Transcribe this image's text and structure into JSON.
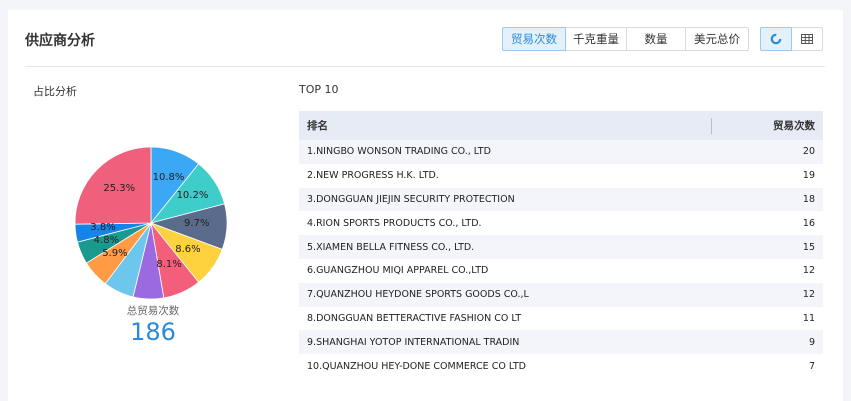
{
  "panel": {
    "title": "供应商分析"
  },
  "metric_tabs": [
    {
      "label": "贸易次数",
      "active": true
    },
    {
      "label": "千克重量",
      "active": false
    },
    {
      "label": "数量",
      "active": false
    },
    {
      "label": "美元总价",
      "active": false
    }
  ],
  "view_toggle": {
    "chart_icon": "pie-chart-icon",
    "table_icon": "table-icon",
    "active": "chart"
  },
  "share": {
    "label": "占比分析"
  },
  "top": {
    "label": "TOP 10",
    "headers": {
      "rank": "排名",
      "count": "贸易次数"
    },
    "rows": [
      {
        "name": "1.NINGBO WONSON TRADING CO., LTD",
        "count": "20"
      },
      {
        "name": "2.NEW PROGRESS H.K. LTD.",
        "count": "19"
      },
      {
        "name": "3.DONGGUAN JIEJIN SECURITY PROTECTION",
        "count": "18"
      },
      {
        "name": "4.RION SPORTS PRODUCTS CO., LTD.",
        "count": "16"
      },
      {
        "name": "5.XIAMEN BELLA FITNESS CO., LTD.",
        "count": "15"
      },
      {
        "name": "6.GUANGZHOU MIQI APPAREL CO.,LTD",
        "count": "12"
      },
      {
        "name": "7.QUANZHOU HEYDONE SPORTS GOODS CO.,L",
        "count": "12"
      },
      {
        "name": "8.DONGGUAN BETTERACTIVE FASHION CO LT",
        "count": "11"
      },
      {
        "name": "9.SHANGHAI YOTOP INTERNATIONAL TRADIN",
        "count": "9"
      },
      {
        "name": "10.QUANZHOU HEY-DONE COMMERCE CO LTD",
        "count": "7"
      }
    ]
  },
  "total": {
    "label": "总贸易次数",
    "value": "186"
  },
  "chart_data": {
    "type": "pie",
    "unit": "percent",
    "slices": [
      {
        "value": 10.8,
        "label": "10.8%",
        "color": "#3ba8f5"
      },
      {
        "value": 10.2,
        "label": "10.2%",
        "color": "#3ecdc8"
      },
      {
        "value": 9.7,
        "label": "9.7%",
        "color": "#5a6b8c"
      },
      {
        "value": 8.6,
        "label": "8.6%",
        "color": "#fdd23e"
      },
      {
        "value": 8.1,
        "label": "8.1%",
        "color": "#f35e7a"
      },
      {
        "value": 6.5,
        "label": "",
        "color": "#9c6ae0"
      },
      {
        "value": 6.5,
        "label": "",
        "color": "#6dc6ec"
      },
      {
        "value": 5.9,
        "label": "5.9%",
        "color": "#ff9a45"
      },
      {
        "value": 4.8,
        "label": "4.8%",
        "color": "#1a9a8f"
      },
      {
        "value": 3.8,
        "label": "3.8%",
        "color": "#1683e8"
      },
      {
        "value": 25.3,
        "label": "25.3%",
        "color": "#f0607c"
      }
    ]
  }
}
